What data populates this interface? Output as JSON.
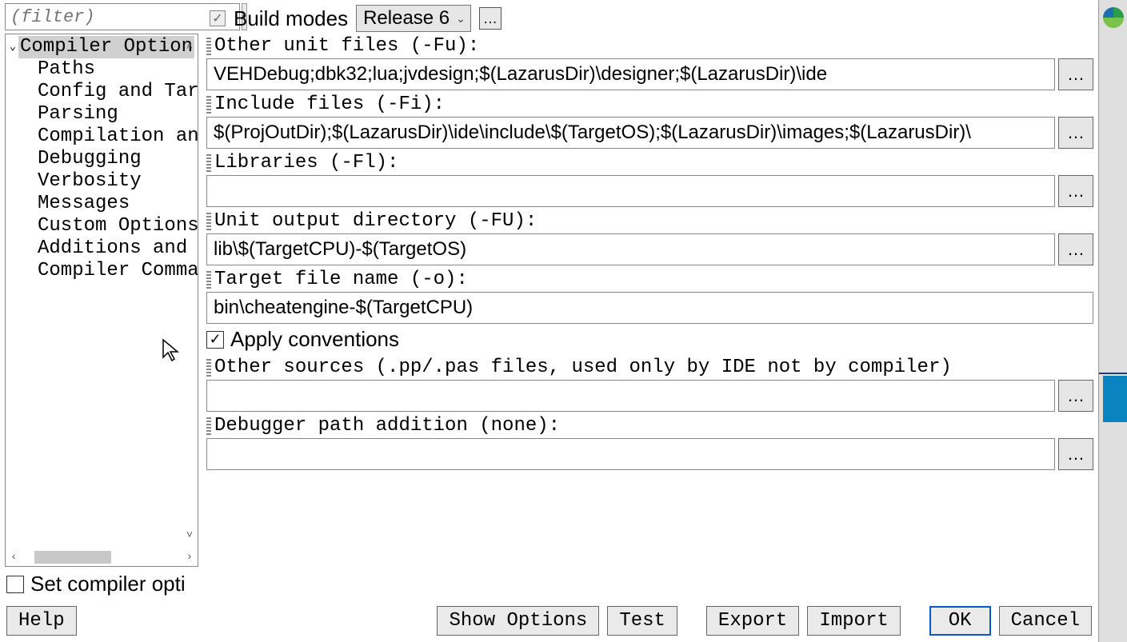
{
  "filter": {
    "placeholder": "(filter)"
  },
  "tree": {
    "root": "Compiler Option",
    "items": [
      "Paths",
      "Config and Tar",
      "Parsing",
      "Compilation an",
      "Debugging",
      "Verbosity",
      "Messages",
      "Custom Options",
      "Additions and",
      "Compiler Comma"
    ]
  },
  "build": {
    "label": "Build modes",
    "selected": "Release 6",
    "extra_btn": "…"
  },
  "fields": {
    "other_unit": {
      "label": "Other unit files (-Fu):",
      "value": "VEHDebug;dbk32;lua;jvdesign;$(LazarusDir)\\designer;$(LazarusDir)\\ide"
    },
    "include": {
      "label": "Include files (-Fi):",
      "value": "$(ProjOutDir);$(LazarusDir)\\ide\\include\\$(TargetOS);$(LazarusDir)\\images;$(LazarusDir)\\"
    },
    "libraries": {
      "label": "Libraries (-Fl):",
      "value": ""
    },
    "unit_out": {
      "label": "Unit output directory (-FU):",
      "value": "lib\\$(TargetCPU)-$(TargetOS)"
    },
    "target": {
      "label": "Target file name (-o):",
      "value": "bin\\cheatengine-$(TargetCPU)"
    },
    "apply_conventions": "Apply conventions",
    "other_sources": {
      "label": "Other sources (.pp/.pas files, used only by IDE not by compiler)",
      "value": ""
    },
    "debugger_path": {
      "label": "Debugger path addition (none):",
      "value": ""
    },
    "browse": "…"
  },
  "set_compiler": "Set compiler opti",
  "buttons": {
    "help": "Help",
    "show_options": "Show Options",
    "test": "Test",
    "export": "Export",
    "import": "Import",
    "ok": "OK",
    "cancel": "Cancel"
  }
}
